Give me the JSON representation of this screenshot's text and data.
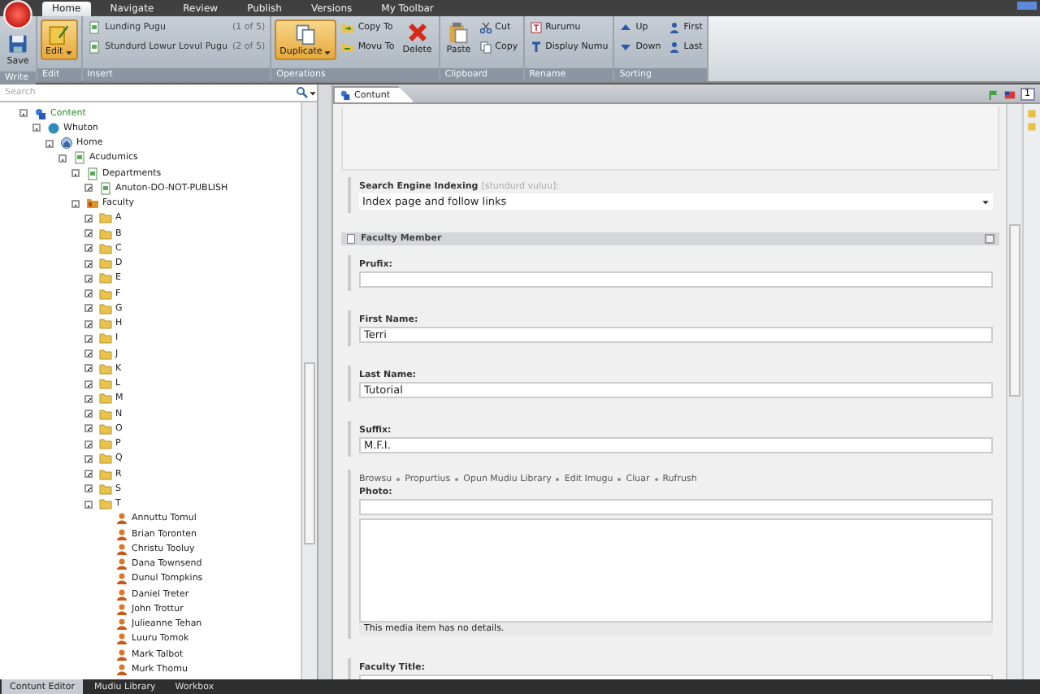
{
  "menu_tabs": [
    {
      "label": "Home",
      "selected": true
    },
    {
      "label": "Navigate",
      "selected": false
    },
    {
      "label": "Review",
      "selected": false
    },
    {
      "label": "Publish",
      "selected": false
    },
    {
      "label": "Versions",
      "selected": false
    },
    {
      "label": "My Toolbar",
      "selected": false
    }
  ],
  "ribbon_groups": [
    {
      "title": "Write",
      "buttons": [
        {
          "kind": "large",
          "label": "Save",
          "dropdown": false
        }
      ]
    },
    {
      "title": "Edit",
      "buttons": [
        {
          "kind": "large",
          "label": "Edit",
          "dropdown": true
        }
      ]
    },
    {
      "title": "Insert",
      "buttons": [
        {
          "kind": "insert",
          "label": "Lunding Pugu",
          "count": "(1 of 5)"
        },
        {
          "kind": "insert",
          "label": "Stundurd Lowur Lovul Pugu",
          "count": "(2 of 5)"
        }
      ]
    },
    {
      "title": "Operations",
      "buttons": [
        {
          "kind": "large",
          "label": "Duplicate",
          "dropdown": true
        },
        {
          "kind": "small",
          "label": "Copy To"
        },
        {
          "kind": "small",
          "label": "Movu To"
        },
        {
          "kind": "large",
          "label": "Delete",
          "dropdown": false
        }
      ]
    },
    {
      "title": "Clipboard",
      "buttons": [
        {
          "kind": "large",
          "label": "Paste",
          "dropdown": false
        },
        {
          "kind": "small",
          "label": "Cut"
        },
        {
          "kind": "small",
          "label": "Copy"
        }
      ]
    },
    {
      "title": "Rename",
      "buttons": [
        {
          "kind": "small",
          "label": "Rurumu"
        },
        {
          "kind": "small",
          "label": "Displuy Numu"
        }
      ]
    },
    {
      "title": "Sorting",
      "buttons": [
        {
          "kind": "small",
          "label": "Up"
        },
        {
          "kind": "small",
          "label": "Down"
        },
        {
          "kind": "small",
          "label": "First"
        },
        {
          "kind": "small",
          "label": "Last"
        }
      ]
    }
  ],
  "search": {
    "placeholder": "Search"
  },
  "tree": [
    {
      "label": "Content",
      "kind": "content",
      "expanded": true,
      "children": [
        {
          "label": "Whuton",
          "kind": "globe",
          "expanded": true,
          "children": [
            {
              "label": "Home",
              "kind": "home",
              "expanded": true,
              "children": [
                {
                  "label": "Acudumics",
                  "kind": "page",
                  "expanded": true,
                  "children": [
                    {
                      "label": "Departments",
                      "kind": "page",
                      "expanded": true,
                      "children": [
                        {
                          "label": "Anuton-DO-NOT-PUBLISH",
                          "kind": "page",
                          "expanded": false
                        }
                      ]
                    },
                    {
                      "label": "Faculty",
                      "kind": "faculty",
                      "expanded": true,
                      "children": [
                        {
                          "label": "A",
                          "kind": "folder",
                          "expanded": false
                        },
                        {
                          "label": "B",
                          "kind": "folder",
                          "expanded": false
                        },
                        {
                          "label": "C",
                          "kind": "folder",
                          "expanded": false
                        },
                        {
                          "label": "D",
                          "kind": "folder",
                          "expanded": false
                        },
                        {
                          "label": "E",
                          "kind": "folder",
                          "expanded": false
                        },
                        {
                          "label": "F",
                          "kind": "folder",
                          "expanded": false
                        },
                        {
                          "label": "G",
                          "kind": "folder",
                          "expanded": false
                        },
                        {
                          "label": "H",
                          "kind": "folder",
                          "expanded": false
                        },
                        {
                          "label": "I",
                          "kind": "folder",
                          "expanded": false
                        },
                        {
                          "label": "J",
                          "kind": "folder",
                          "expanded": false
                        },
                        {
                          "label": "K",
                          "kind": "folder",
                          "expanded": false
                        },
                        {
                          "label": "L",
                          "kind": "folder",
                          "expanded": false
                        },
                        {
                          "label": "M",
                          "kind": "folder",
                          "expanded": false
                        },
                        {
                          "label": "N",
                          "kind": "folder",
                          "expanded": false
                        },
                        {
                          "label": "O",
                          "kind": "folder",
                          "expanded": false
                        },
                        {
                          "label": "P",
                          "kind": "folder",
                          "expanded": false
                        },
                        {
                          "label": "Q",
                          "kind": "folder",
                          "expanded": false
                        },
                        {
                          "label": "R",
                          "kind": "folder",
                          "expanded": false
                        },
                        {
                          "label": "S",
                          "kind": "folder",
                          "expanded": false
                        },
                        {
                          "label": "T",
                          "kind": "folder",
                          "expanded": true,
                          "children": [
                            {
                              "label": "Annuttu Tomul",
                              "kind": "person"
                            },
                            {
                              "label": "Brian Toronten",
                              "kind": "person"
                            },
                            {
                              "label": "Christu Tooluy",
                              "kind": "person"
                            },
                            {
                              "label": "Dana Townsend",
                              "kind": "person"
                            },
                            {
                              "label": "Dunul Tompkins",
                              "kind": "person"
                            },
                            {
                              "label": "Daniel Treter",
                              "kind": "person"
                            },
                            {
                              "label": "John Trottur",
                              "kind": "person"
                            },
                            {
                              "label": "Julieanne Tehan",
                              "kind": "person"
                            },
                            {
                              "label": "Luuru Tomok",
                              "kind": "person"
                            },
                            {
                              "label": "Mark Talbot",
                              "kind": "person"
                            },
                            {
                              "label": "Murk Thomu",
                              "kind": "person"
                            }
                          ]
                        }
                      ]
                    }
                  ]
                }
              ]
            }
          ]
        }
      ]
    }
  ],
  "editor": {
    "tab": {
      "label": "Contunt",
      "selected": true
    },
    "version": "1",
    "fields": [
      {
        "kind": "dropdown",
        "label": "Search Engine Indexing",
        "hint": "[stundurd vuluu]:",
        "value": "Index page and follow links"
      }
    ],
    "section": {
      "title": "Faculty Member",
      "expanded": true,
      "fields": [
        {
          "kind": "text",
          "label": "Prufix:"
        },
        {
          "kind": "text",
          "label": "First Name:",
          "value": "Terri"
        },
        {
          "kind": "text",
          "label": "Last Name:",
          "value": "Tutorial"
        },
        {
          "kind": "text",
          "label": "Suffix:",
          "value": "M.F.I."
        },
        {
          "kind": "image",
          "links": [
            "Browsu",
            "Propurtius",
            "Opun Mudiu Library",
            "Edit Imugu",
            "Cluar",
            "Rufrush"
          ],
          "label": "Photo:",
          "note": "This media item has no details."
        },
        {
          "kind": "text",
          "label": "Faculty Title:"
        }
      ]
    }
  },
  "bottom_tabs": [
    {
      "label": "Contunt Editor",
      "selected": true
    },
    {
      "label": "Mudiu Library",
      "selected": false
    },
    {
      "label": "Workbox",
      "selected": false
    }
  ]
}
